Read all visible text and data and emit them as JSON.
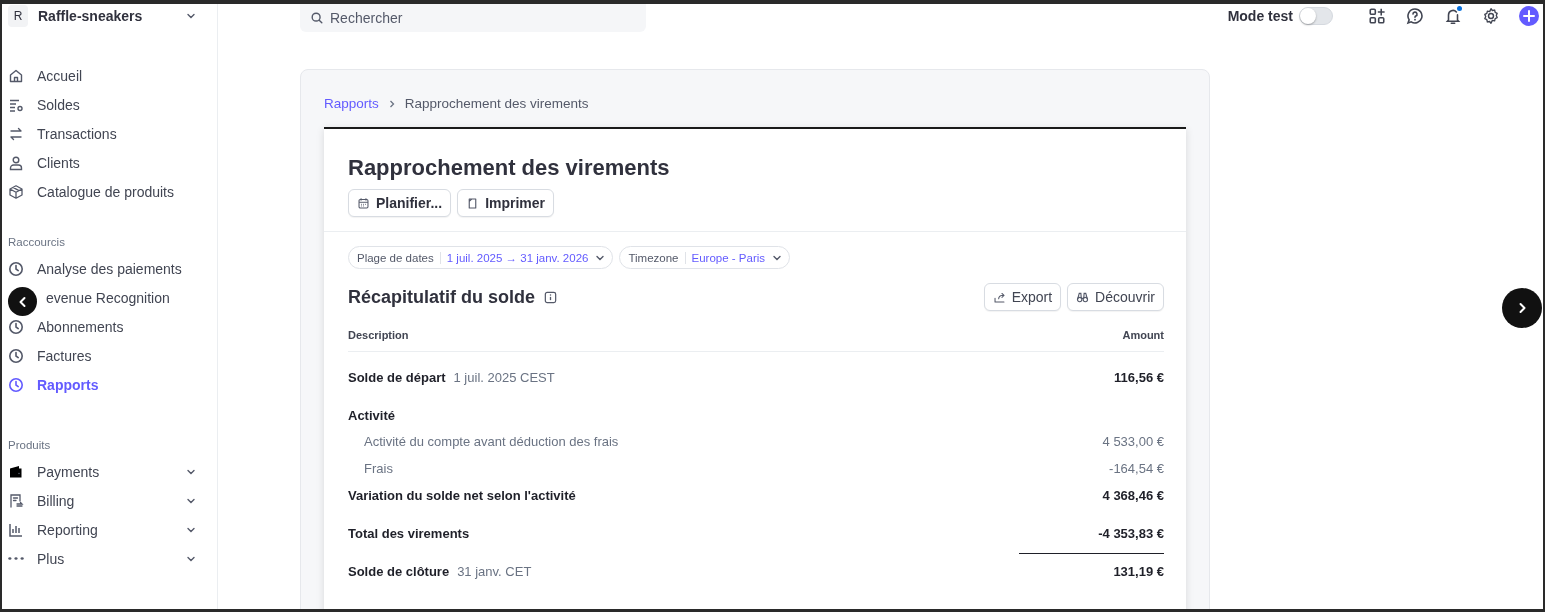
{
  "account": {
    "initial": "R",
    "name": "Raffle-sneakers"
  },
  "nav": [
    {
      "label": "Accueil",
      "selected": false
    },
    {
      "label": "Soldes",
      "selected": false
    },
    {
      "label": "Transactions",
      "selected": false
    },
    {
      "label": "Clients",
      "selected": false
    },
    {
      "label": "Catalogue de produits",
      "selected": false
    }
  ],
  "shortcuts": {
    "title": "Raccourcis",
    "items": [
      {
        "label": "Analyse des paiements",
        "selected": false
      },
      {
        "label": "evenue Recognition",
        "selected": false,
        "covered": true
      },
      {
        "label": "Abonnements",
        "selected": false
      },
      {
        "label": "Factures",
        "selected": false
      },
      {
        "label": "Rapports",
        "selected": true
      }
    ]
  },
  "products": {
    "title": "Produits",
    "items": [
      {
        "label": "Payments",
        "expanded": false
      },
      {
        "label": "Billing",
        "expanded": false
      },
      {
        "label": "Reporting",
        "expanded": false
      },
      {
        "label": "Plus",
        "expanded": false
      }
    ]
  },
  "search": {
    "placeholder": "Rechercher"
  },
  "topbar": {
    "mode_label": "Mode test",
    "mode_on": false,
    "notification": true
  },
  "breadcrumb": {
    "parent": "Rapports",
    "current": "Rapprochement des virements"
  },
  "report": {
    "title": "Rapprochement des virements",
    "actions": [
      "Planifier...",
      "Imprimer"
    ],
    "filters": [
      {
        "label": "Plage de dates",
        "value": "1 juil. 2025 → 31 janv. 2026"
      },
      {
        "label": "Timezone",
        "value": "Europe - Paris"
      }
    ],
    "section_title": "Récapitulatif du solde",
    "section_actions": [
      "Export",
      "Découvrir"
    ],
    "columns": [
      "Description",
      "Amount"
    ],
    "rows": [
      {
        "kind": "main",
        "label": "Solde de départ",
        "note": "1 juil. 2025 CEST",
        "amount": "116,56 €"
      },
      {
        "kind": "group",
        "label": "Activité"
      },
      {
        "kind": "detail",
        "label": "Activité du compte avant déduction des frais",
        "amount": "4 533,00 €"
      },
      {
        "kind": "detail",
        "label": "Frais",
        "amount": "-164,54 €"
      },
      {
        "kind": "subtotal",
        "label": "Variation du solde net selon l'activité",
        "amount": "4 368,46 €"
      },
      {
        "kind": "total",
        "label": "Total des virements",
        "amount": "-4 353,83 €"
      },
      {
        "kind": "main",
        "label": "Solde de clôture",
        "note": "31 janv. CET",
        "amount": "131,19 €"
      }
    ]
  }
}
